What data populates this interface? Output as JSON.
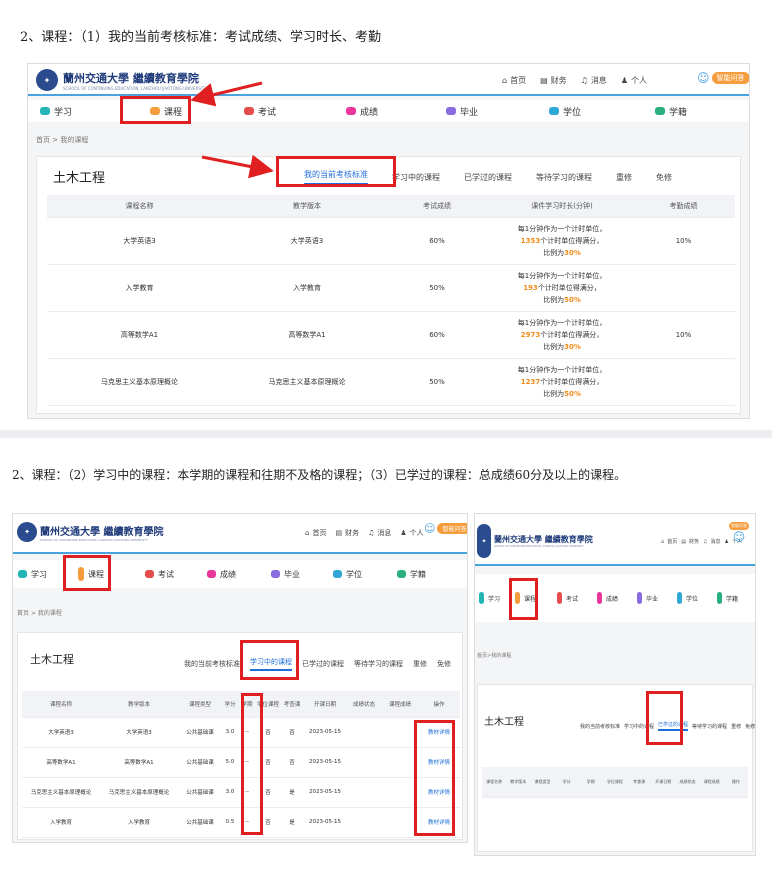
{
  "heading1": "2、课程：（1）我的当前考核标准：考试成绩、学习时长、考勤",
  "heading2": "2、课程：（2）学习中的课程：本学期的课程和往期不及格的课程；（3）已学过的课程：总成绩60分及以上的课程。",
  "logo": {
    "name": "蘭州交通大學 繼續教育學院",
    "sub": "SCHOOL OF CONTINUING EDUCATION, LANZHOU JIAOTONG UNIVERSITY"
  },
  "toplinks": {
    "home": "首页",
    "finance": "财务",
    "message": "消息",
    "personal": "个人"
  },
  "badge": "智能问答",
  "nav": [
    "学习",
    "课程",
    "考试",
    "成绩",
    "毕业",
    "学位",
    "学籍"
  ],
  "nav_colors": [
    "#23b5b5",
    "#f59c3c",
    "#e74c4c",
    "#e8369a",
    "#8a6be0",
    "#2fa8d8",
    "#2ab07f"
  ],
  "breadcrumb": "首页 > 我的课程",
  "breadcrumb_short": "首页>我的课程",
  "major": "土木工程",
  "tabs": [
    "我的当前考核标准",
    "学习中的课程",
    "已学过的课程",
    "等待学习的课程",
    "重修",
    "免修"
  ],
  "standard_table": {
    "headers": [
      "课程名称",
      "教学版本",
      "考试成绩",
      "课件学习时长(分钟)",
      "考勤成绩"
    ],
    "rows": [
      {
        "course": "大学英语3",
        "version": "大学英语3",
        "exam": "60%",
        "l1": "每1分钟作为一个计时单位，",
        "n": "1353",
        "l2": "个计时单位得满分，",
        "l3": "比例为",
        "pct": "30%",
        "att": "10%"
      },
      {
        "course": "入学教育",
        "version": "入学教育",
        "exam": "50%",
        "l1": "每1分钟作为一个计时单位，",
        "n": "193",
        "l2": "个计时单位得满分，",
        "l3": "比例为",
        "pct": "50%",
        "att": ""
      },
      {
        "course": "高等数学A1",
        "version": "高等数学A1",
        "exam": "60%",
        "l1": "每1分钟作为一个计时单位，",
        "n": "2973",
        "l2": "个计时单位得满分，",
        "l3": "比例为",
        "pct": "30%",
        "att": "10%"
      },
      {
        "course": "马克思主义基本原理概论",
        "version": "马克思主义基本原理概论",
        "exam": "50%",
        "l1": "每1分钟作为一个计时单位，",
        "n": "1237",
        "l2": "个计时单位得满分，",
        "l3": "比例为",
        "pct": "50%",
        "att": ""
      }
    ]
  },
  "learning_table": {
    "headers": [
      "课程名称",
      "教学版本",
      "课程类型",
      "学分",
      "学期",
      "学位课程",
      "考查课",
      "开课日期",
      "成绩状态",
      "课程成绩",
      "操作"
    ],
    "rows": [
      [
        "大学英语3",
        "大学英语3",
        "公共基础课",
        "3.0",
        "--",
        "否",
        "否",
        "2023-05-15",
        "",
        "",
        "教材详情"
      ],
      [
        "高等数学A1",
        "高等数学A1",
        "公共基础课",
        "5.0",
        "--",
        "否",
        "否",
        "2023-05-15",
        "",
        "",
        "教材详情"
      ],
      [
        "马克思主义基本原理概论",
        "马克思主义基本原理概论",
        "公共基础课",
        "3.0",
        "--",
        "否",
        "是",
        "2023-05-15",
        "",
        "",
        "教材详情"
      ],
      [
        "入学教育",
        "入学教育",
        "公共基础课",
        "0.5",
        "--",
        "否",
        "是",
        "2023-05-15",
        "",
        "",
        "教材详情"
      ]
    ]
  },
  "learned_headers": [
    "课程名称",
    "教学版本",
    "课程类型",
    "学分",
    "学期",
    "学位课程",
    "考查课",
    "开课日期",
    "成绩状态",
    "课程成绩",
    "操作"
  ],
  "colors": {
    "accent": "#1e6fd9",
    "highlight": "#f08c1a",
    "annotation": "#e02020"
  }
}
